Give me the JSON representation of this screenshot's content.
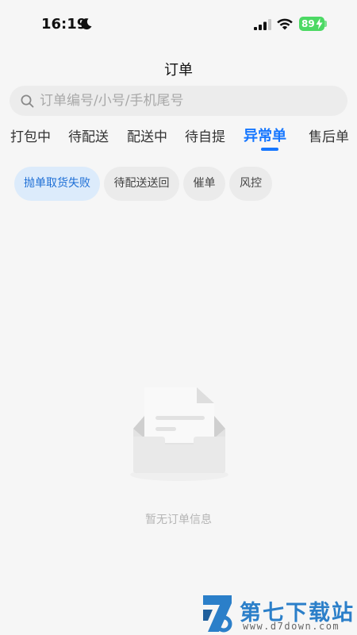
{
  "status_bar": {
    "time": "16:19",
    "battery": "89"
  },
  "header": {
    "title": "订单"
  },
  "search": {
    "placeholder": "订单编号/小号/手机尾号",
    "value": ""
  },
  "tabs": [
    {
      "label": "打包中"
    },
    {
      "label": "待配送"
    },
    {
      "label": "配送中"
    },
    {
      "label": "待自提"
    },
    {
      "label": "异常单",
      "active": true
    },
    {
      "label": "售后单"
    }
  ],
  "filters": [
    {
      "label": "抛单取货失败",
      "active": true
    },
    {
      "label": "待配送送回"
    },
    {
      "label": "催单"
    },
    {
      "label": "风控"
    }
  ],
  "empty_state": {
    "message": "暂无订单信息"
  },
  "watermark": {
    "name": "第七下载站",
    "url": "www.d7down.com"
  },
  "colors": {
    "accent": "#1677ff",
    "chip_active_bg": "#dcebfb",
    "battery": "#4cd964"
  }
}
